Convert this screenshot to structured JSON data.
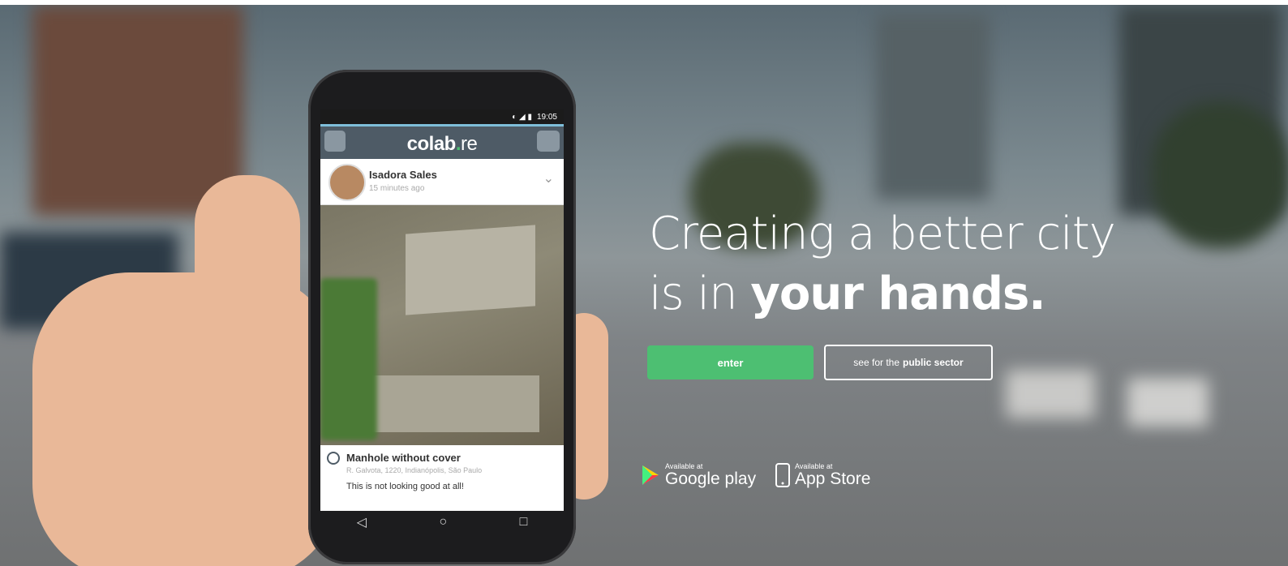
{
  "hero": {
    "headline_line1": "Creating a better city",
    "headline_line2_prefix": "is in ",
    "headline_line2_bold": "your hands.",
    "enter_label": "enter",
    "public_prefix": "see for the",
    "public_bold": "public sector",
    "google_small": "Available at",
    "google_big": "Google play",
    "apple_small": "Available at",
    "apple_big": "App Store"
  },
  "app": {
    "status_time": "19:05",
    "logo_main": "colab",
    "logo_dot": ".",
    "logo_ext": "re",
    "post": {
      "name": "Isadora Sales",
      "time": "15 minutes ago",
      "title": "Manhole without cover",
      "address": "R. Galvota, 1220, Indianópolis, São Paulo",
      "text": "This is not looking good at all!"
    }
  },
  "colors": {
    "accent_green": "#4dbf72",
    "app_bar": "#4e5b66"
  },
  "icons": [
    "menu-icon",
    "mail-icon",
    "chevron-down-icon",
    "google-play-icon",
    "apple-phone-icon",
    "back-icon",
    "home-icon",
    "recents-icon"
  ]
}
